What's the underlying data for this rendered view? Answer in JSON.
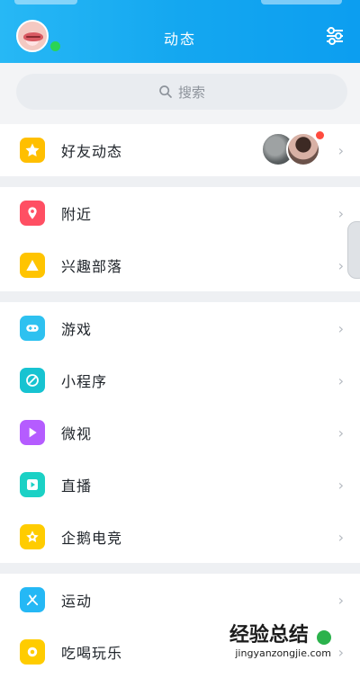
{
  "header": {
    "title": "动态"
  },
  "search": {
    "placeholder": "搜索"
  },
  "sections": [
    {
      "items": [
        {
          "label": "好友动态",
          "icon": "star-icon"
        }
      ]
    },
    {
      "items": [
        {
          "label": "附近",
          "icon": "location-icon"
        },
        {
          "label": "兴趣部落",
          "icon": "triangle-icon"
        }
      ]
    },
    {
      "items": [
        {
          "label": "游戏",
          "icon": "gamepad-icon"
        },
        {
          "label": "小程序",
          "icon": "mini-program-icon"
        },
        {
          "label": "微视",
          "icon": "play-icon"
        },
        {
          "label": "直播",
          "icon": "live-icon"
        },
        {
          "label": "企鹅电竞",
          "icon": "esports-icon"
        }
      ]
    },
    {
      "items": [
        {
          "label": "运动",
          "icon": "sport-icon"
        },
        {
          "label": "吃喝玩乐",
          "icon": "food-icon"
        }
      ]
    }
  ],
  "watermark": {
    "cn": "经验总结",
    "url": "jingyanzongjie.com"
  },
  "colors": {
    "header": "#14a7f0",
    "star": "#ffbf00",
    "location": "#ff4f63",
    "triangle": "#ffc400",
    "gamepad": "#2ec1f0",
    "mini_program": "#17c3d1",
    "play": "#b55cff",
    "live": "#1bd1c5",
    "esports": "#ffcc00",
    "sport": "#25b8f5",
    "food": "#ffcc00"
  }
}
